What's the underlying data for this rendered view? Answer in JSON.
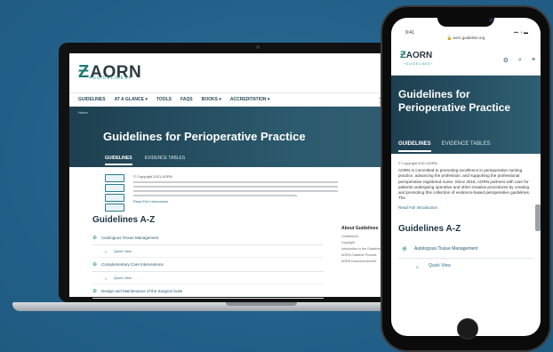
{
  "brand": {
    "logo_mark": "Ƶ",
    "logo_text": "AORN",
    "logo_sub": "+GUIDELINES+"
  },
  "laptop": {
    "nav": [
      "GUIDELINES",
      "AT A GLANCE ▾",
      "TOOLS",
      "FAQS",
      "BOOKS ▾",
      "ACCREDITATION ▾"
    ],
    "search_placeholder": "Search...",
    "breadcrumb": "Home",
    "page_title": "Guidelines for Perioperative Practice",
    "tabs": [
      "GUIDELINES",
      "EVIDENCE TABLES"
    ],
    "intro": {
      "copyright": "© Copyright 2021 AORN",
      "read_full": "Read Full Introduction"
    },
    "az_title": "Guidelines A-Z",
    "az_items": [
      {
        "label": "Autologous Tissue Management",
        "sub": "Quick View"
      },
      {
        "label": "Complementary Care Interventions",
        "sub": "Quick View"
      },
      {
        "label": "Design and Maintenance of the Surgical Suite",
        "sub": ""
      }
    ],
    "about": {
      "title": "About Guidelines",
      "lines": [
        "Contributors",
        "Copyright",
        "Introduction to the Guidelines for Perioperative Practice",
        "AORN Guideline Process",
        "AORN Document Archive"
      ]
    }
  },
  "phone": {
    "status_time": "9:41",
    "status_icons": "▪▪▪ ◔ ▬",
    "url": "🔒 aorn.guideline.org",
    "icons": [
      "⚙",
      "⌕",
      "≡"
    ],
    "page_title": "Guidelines for Perioperative Practice",
    "tabs": [
      "GUIDELINES",
      "EVIDENCE TABLES"
    ],
    "copyright": "© Copyright 2021 AORN",
    "paragraph": "AORN is committed to promoting excellence in perioperative nursing practice, advancing the profession, and supporting the professional perioperative registered nurse. Since 2016, AORN partners with care for patients undergoing operative and other invasive procedures by creating and promoting this collection of evidence-based perioperative guidelines. The",
    "read_full": "Read Full Introduction",
    "az_title": "Guidelines A-Z",
    "az_item": "Autologous Tissue Management",
    "az_sub": "Quick View"
  }
}
